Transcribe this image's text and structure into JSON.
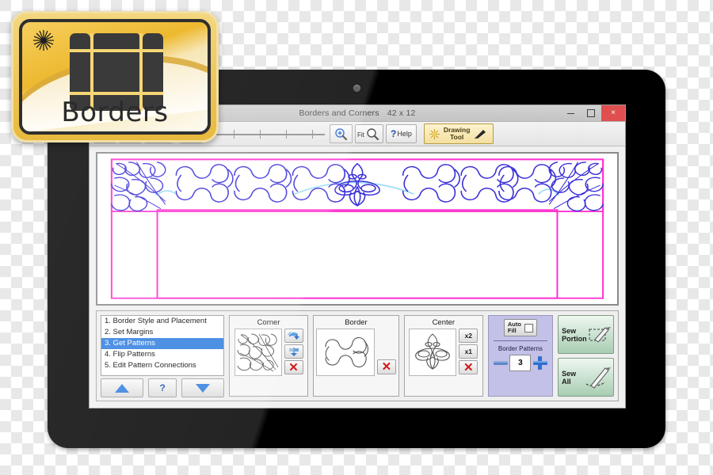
{
  "badge": {
    "word": "Borders",
    "star_icon": "starburst-icon",
    "grid_icon": "border-frame-icon"
  },
  "device": {
    "name": "tablet-device",
    "camera": "front-camera"
  },
  "window": {
    "title": "Borders and Corners",
    "dimensions": "42 x 12",
    "buttons": {
      "minimize": "minimize-button",
      "maximize": "maximize-button",
      "close_label": "×"
    }
  },
  "toolbar": {
    "undo": "undo-icon",
    "redo": "redo-icon",
    "eraser": "eraser-tool-icon",
    "zoom_out": "zoom-out-icon",
    "zoom_in": "zoom-in-icon",
    "fit_label": "Fit",
    "help_q": "?",
    "help_label": "Help",
    "drawing_tool_line1": "Drawing",
    "drawing_tool_line2": "Tool",
    "slider_value": 0,
    "slider_ticks": 4
  },
  "canvas": {
    "name": "design-canvas",
    "border_color": "#ff2fd2",
    "pattern_color": "#3a2fd8",
    "connector_color": "#8fd8f2",
    "background": "#ffffff"
  },
  "steps": {
    "items": [
      {
        "label": "1. Border Style and Placement",
        "selected": false
      },
      {
        "label": "2. Set Margins",
        "selected": false
      },
      {
        "label": "3. Get Patterns",
        "selected": true
      },
      {
        "label": "4. Flip Patterns",
        "selected": false
      },
      {
        "label": "5. Edit Pattern Connections",
        "selected": false
      }
    ],
    "nav": {
      "up": "step-up-arrow",
      "help": "?",
      "down": "step-down-arrow"
    }
  },
  "patterns": {
    "corner": {
      "title": "Corner",
      "buttons": {
        "rotate": "rotate-icon",
        "flip": "flip-icon",
        "delete": "✕"
      }
    },
    "border": {
      "title": "Border",
      "buttons": {
        "delete": "✕"
      }
    },
    "center": {
      "title": "Center",
      "buttons": {
        "double": "x2",
        "single": "x1",
        "delete": "✕"
      }
    }
  },
  "controls": {
    "auto_fill_line1": "Auto",
    "auto_fill_line2": "Fill",
    "auto_fill_checked": false,
    "border_patterns_label": "Border Patterns",
    "border_patterns_value": "3",
    "minus": "minus-icon",
    "plus": "plus-icon"
  },
  "sew": {
    "portion_line1": "Sew",
    "portion_line2": "Portion",
    "all_line1": "Sew",
    "all_line2": "All"
  },
  "colors": {
    "accent_blue": "#2f7ddf",
    "close_red": "#e04f4f",
    "sew_green": "#a8cdb2",
    "panel_purple": "#c3c1e8",
    "gold": "#e8b93e"
  }
}
